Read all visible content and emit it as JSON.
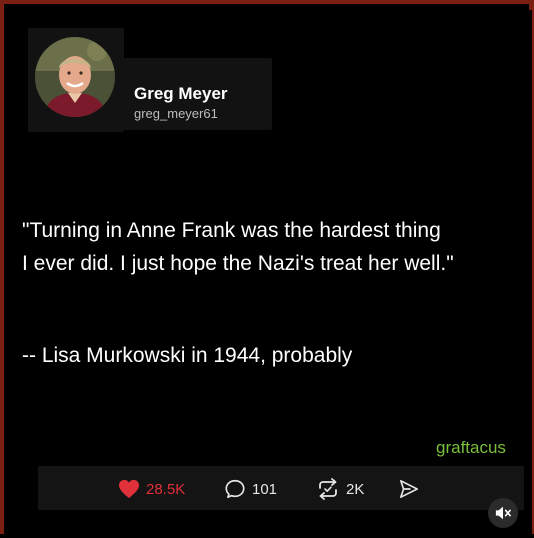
{
  "post": {
    "author": {
      "name": "Greg Meyer",
      "handle": "greg_meyer61"
    },
    "quote_lines": [
      "\"Turning in Anne Frank was the hardest thing",
      "I ever did. I just hope the Nazi's treat her well.\""
    ],
    "attribution": "-- Lisa Murkowski in 1944, probably",
    "watermark": "graftacus"
  },
  "actions": {
    "likes": "28.5K",
    "comments": "101",
    "reposts": "2K"
  },
  "colors": {
    "background": "#000000",
    "border": "#7a1f12",
    "like_red": "#e0303a",
    "watermark_green": "#7bbf3c"
  },
  "icons": [
    "heart-icon",
    "comment-icon",
    "repost-icon",
    "share-icon",
    "mute-icon"
  ]
}
